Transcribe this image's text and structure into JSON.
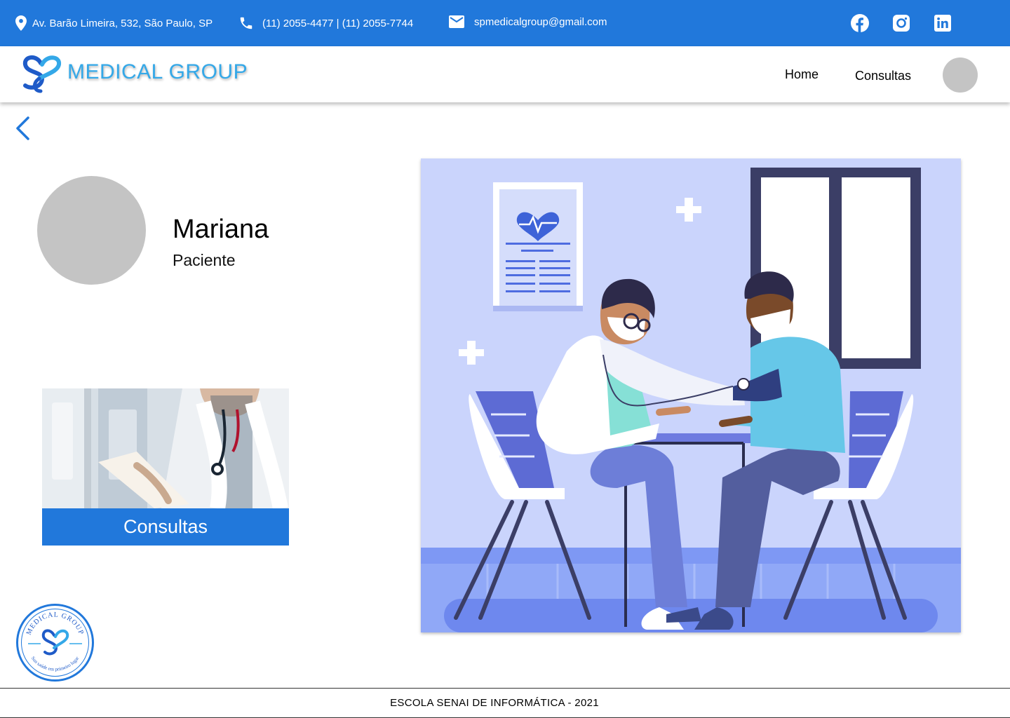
{
  "topbar": {
    "address": "Av. Barão Limeira, 532, São Paulo, SP",
    "phones": "(11) 2055-4477 | (11) 2055-7744",
    "email": "spmedicalgroup@gmail.com",
    "background_color": "#2178DB",
    "icons": [
      "location-pin-icon",
      "phone-icon",
      "mail-icon"
    ],
    "social_icons": [
      "facebook-icon",
      "instagram-icon",
      "linkedin-icon"
    ]
  },
  "header": {
    "brand": "MEDICAL GROUP",
    "brand_color": "#34A8E8",
    "nav": {
      "home": "Home",
      "consultas": "Consultas"
    }
  },
  "profile": {
    "name": "Mariana",
    "role": "Paciente"
  },
  "card": {
    "label": "Consultas",
    "color": "#2178DB"
  },
  "seal": {
    "top_text": "MEDICAL GROUP",
    "bottom_text": "Sua saúde em primeiro lugar"
  },
  "footer": {
    "text": "ESCOLA SENAI DE INFORMÁTICA - 2021"
  }
}
